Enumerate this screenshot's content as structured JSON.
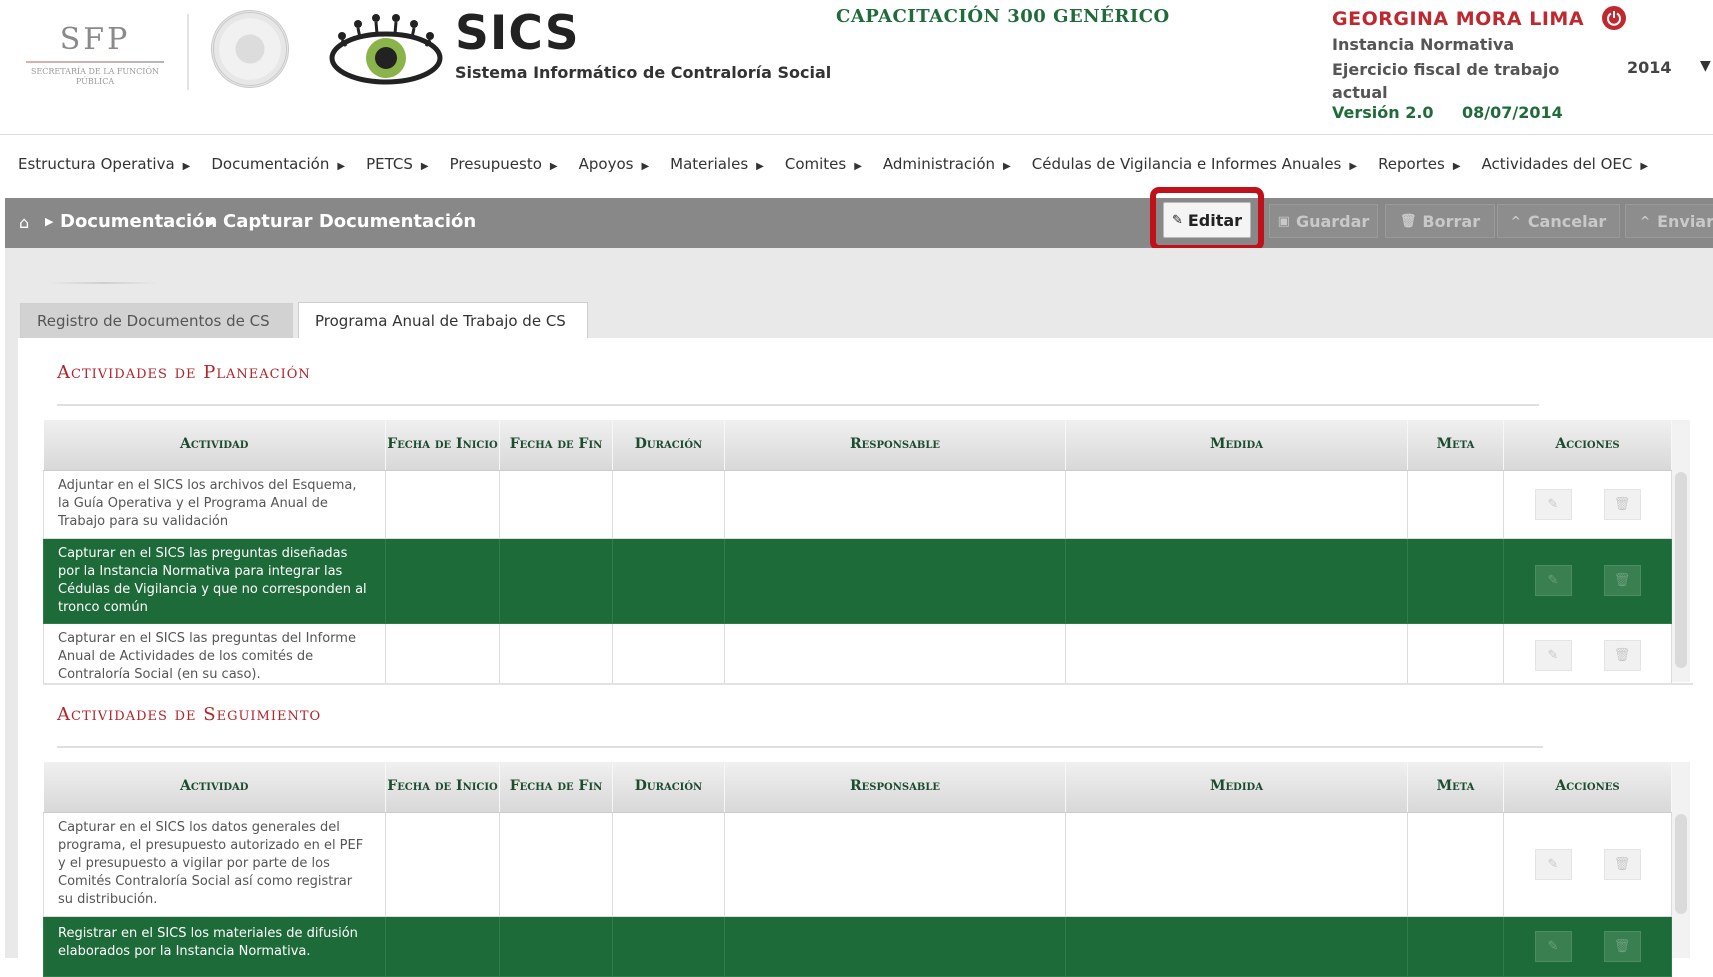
{
  "header": {
    "sfp": "SFP",
    "sfp_sub": "SECRETARÍA DE LA FUNCIÓN PÚBLICA",
    "app_name": "SICS",
    "app_subtitle": "Sistema Informático de Contraloría Social",
    "program": "CAPACITACIÓN 300 GENÉRICO",
    "user": "GEORGINA MORA LIMA",
    "role": "Instancia Normativa",
    "fiscal_label": "Ejercicio fiscal de trabajo actual",
    "fiscal_year": "2014",
    "version": "Versión 2.0",
    "version_date": "08/07/2014"
  },
  "menu": [
    "Estructura Operativa",
    "Documentación",
    "PETCS",
    "Presupuesto",
    "Apoyos",
    "Materiales",
    "Comites",
    "Administración",
    "Cédulas de Vigilancia e Informes Anuales",
    "Reportes",
    "Actividades del OEC"
  ],
  "breadcrumb": {
    "level1": "Documentación",
    "level2": "Capturar Documentación"
  },
  "toolbar": {
    "edit": "Editar",
    "save": "Guardar",
    "delete": "Borrar",
    "cancel": "Cancelar",
    "send": "Enviar"
  },
  "tabs": [
    "Registro de Documentos de CS",
    "Programa Anual de Trabajo de CS"
  ],
  "columns": {
    "activity": "Actividad",
    "start": "Fecha de Inicio",
    "end": "Fecha de Fin",
    "duration": "Duración",
    "owner": "Responsable",
    "measure": "Medida",
    "goal": "Meta",
    "actions": "Acciones"
  },
  "planning": {
    "title": "Actividades de Planeación",
    "rows": [
      "Adjuntar en el SICS los archivos del Esquema, la Guía Operativa y el Programa Anual de Trabajo para su validación",
      "Capturar en el SICS las preguntas diseñadas por la Instancia Normativa para integrar las Cédulas de Vigilancia y que no corresponden al tronco común",
      "Capturar en el SICS las preguntas del Informe Anual de Actividades de los comités de Contraloría Social (en su caso)."
    ]
  },
  "followup": {
    "title": "Actividades de Seguimiento",
    "rows": [
      "Capturar en el SICS los datos generales del programa, el presupuesto autorizado en el PEF y el presupuesto a vigilar por parte de los Comités Contraloría Social así como registrar su distribución.",
      "Registrar en el SICS los materiales de difusión elaborados por la Instancia Normativa."
    ]
  },
  "colors": {
    "selected_row": "#1e6b3a",
    "section_title": "#b2232a",
    "highlight_frame": "#c0111a"
  }
}
